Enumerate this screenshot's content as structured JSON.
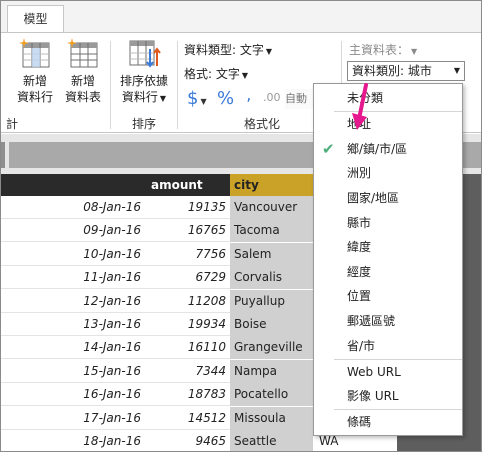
{
  "ribbon": {
    "tab_label": "模型",
    "calc": {
      "new_column": [
        "新增",
        "資料行"
      ],
      "new_table": [
        "新增",
        "資料表"
      ],
      "group_label": "計算"
    },
    "sort": {
      "sort_by_column": [
        "排序依據",
        "資料行"
      ],
      "group_label": "排序"
    },
    "format": {
      "data_type": "資料類型: 文字",
      "format_label": "格式: 文字",
      "currency_symbol": "$",
      "percent_symbol": "%",
      "comma_symbol": " ,",
      "decimal_symbol": ".00",
      "auto_label": "自動",
      "group_label": "格式化"
    },
    "properties": {
      "home_table": "主資料表：",
      "data_category": "資料類別: 城市"
    }
  },
  "table": {
    "headers": {
      "amount": "amount",
      "city": "city"
    },
    "rows": [
      {
        "date": "08-Jan-16",
        "amount": "19135",
        "city": "Vancouver",
        "state": ""
      },
      {
        "date": "09-Jan-16",
        "amount": "16765",
        "city": "Tacoma",
        "state": ""
      },
      {
        "date": "10-Jan-16",
        "amount": "7756",
        "city": "Salem",
        "state": ""
      },
      {
        "date": "11-Jan-16",
        "amount": "6729",
        "city": "Corvalis",
        "state": ""
      },
      {
        "date": "12-Jan-16",
        "amount": "11208",
        "city": "Puyallup",
        "state": ""
      },
      {
        "date": "13-Jan-16",
        "amount": "19934",
        "city": "Boise",
        "state": ""
      },
      {
        "date": "14-Jan-16",
        "amount": "16110",
        "city": "Grangeville",
        "state": ""
      },
      {
        "date": "15-Jan-16",
        "amount": "7344",
        "city": "Nampa",
        "state": ""
      },
      {
        "date": "16-Jan-16",
        "amount": "18783",
        "city": "Pocatello",
        "state": ""
      },
      {
        "date": "17-Jan-16",
        "amount": "14512",
        "city": "Missoula",
        "state": ""
      },
      {
        "date": "18-Jan-16",
        "amount": "9465",
        "city": "Seattle",
        "state": "WA"
      }
    ]
  },
  "menu": {
    "items": [
      "未分類",
      "地址",
      "鄉/鎮/市/區",
      "洲別",
      "國家/地區",
      "縣市",
      "緯度",
      "經度",
      "位置",
      "郵遞區號",
      "省/市",
      "Web URL",
      "影像 URL",
      "條碼"
    ],
    "selected_index": 2
  },
  "colors": {
    "accent_arrow": "#e6188e",
    "city_header": "#c9a227",
    "check": "#4caf7a",
    "icon_blue": "#3a7ad9"
  }
}
